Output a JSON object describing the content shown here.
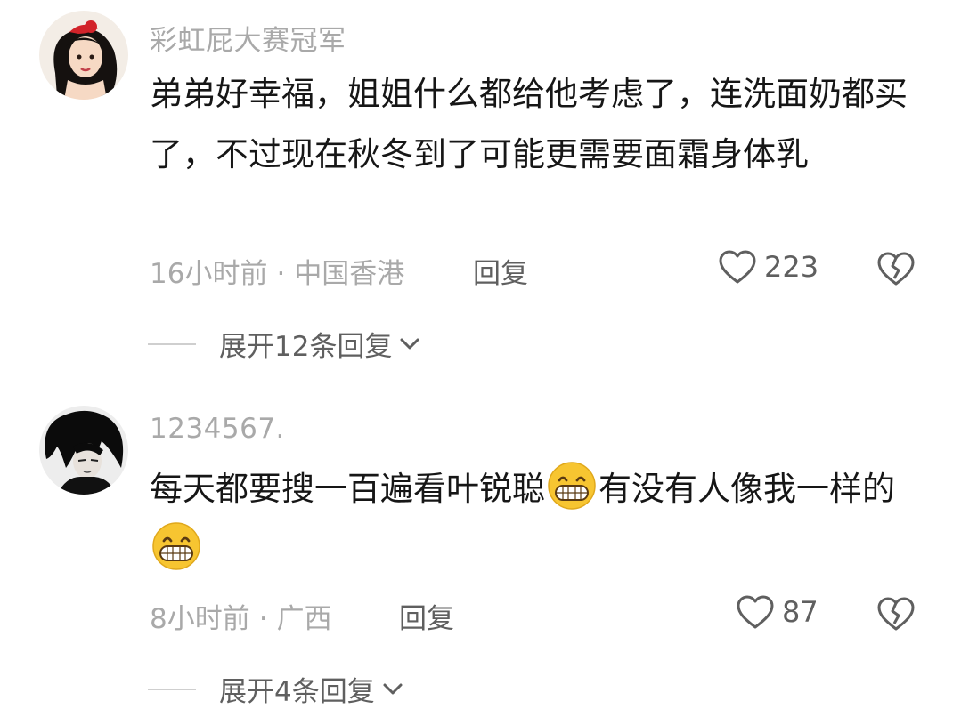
{
  "comments": [
    {
      "username": "彩虹屁大赛冠军",
      "text_segments": [
        "弟弟好幸福，姐姐什么都给他考虑了，连洗面奶都买了，不过现在秋冬到了可能更需要面霜身体乳"
      ],
      "time": "16小时前",
      "separator": "·",
      "location": "中国香港",
      "reply_label": "回复",
      "likes": "223",
      "expand_label": "展开12条回复",
      "icons": {
        "like": "heart-outline-icon",
        "dislike": "broken-heart-icon",
        "expand": "chevron-down-icon"
      }
    },
    {
      "username": "1234567.",
      "text_segments": [
        "每天都要搜一百遍看叶锐聪",
        "有没有人像我一样的"
      ],
      "emoji": "grinning-teeth-emoji",
      "time": "8小时前",
      "separator": "·",
      "location": "广西",
      "reply_label": "回复",
      "likes": "87",
      "expand_label": "展开4条回复",
      "icons": {
        "like": "heart-outline-icon",
        "dislike": "broken-heart-icon",
        "expand": "chevron-down-icon"
      }
    }
  ],
  "colors": {
    "text": "#161616",
    "secondary": "#a9a9a9",
    "action": "#5f5f5f",
    "emoji": "#f7c531"
  }
}
